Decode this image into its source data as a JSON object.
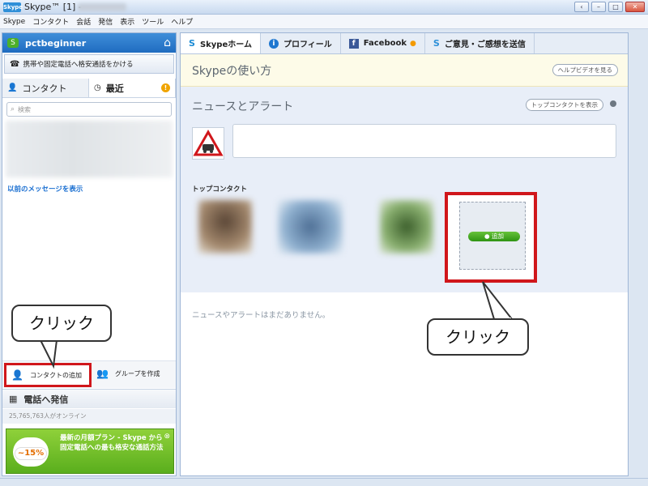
{
  "window": {
    "app_icon": "Skype",
    "title": "Skype™ [1] -",
    "buttons": [
      "‹",
      "–",
      "□",
      "✕"
    ]
  },
  "menubar": [
    "Skype",
    "コンタクト",
    "会話",
    "発信",
    "表示",
    "ツール",
    "ヘルプ"
  ],
  "left": {
    "user": {
      "name": "pctbeginner",
      "status_icon": "S",
      "home_icon": "⌂"
    },
    "call_link": "携帯や固定電話へ格安通話をかける",
    "tabs": [
      {
        "label": "コンタクト",
        "icon": "👤"
      },
      {
        "label": "最近",
        "icon": "◷",
        "badge": "!"
      }
    ],
    "search_placeholder": "検索",
    "show_previous": "以前のメッセージを表示",
    "add_contact": "コンタクトの追加",
    "create_group": "グループを作成",
    "call_phone": "電話へ発信",
    "online_count": "25,765,763人がオンライン",
    "promo": {
      "percent": "~15%",
      "text": "最新の月額プラン - Skype から固定電話への最も格安な通話方法",
      "close": "⊗"
    }
  },
  "right": {
    "tabs": [
      {
        "label": "Skypeホーム",
        "icon": "S",
        "active": true
      },
      {
        "label": "プロフィール",
        "icon": "i"
      },
      {
        "label": "Facebook",
        "icon": "f",
        "dot": "●"
      },
      {
        "label": "ご意見・ご感想を送信",
        "icon": "S"
      }
    ],
    "howto_title": "Skypeの使い方",
    "help_video": "ヘルプビデオを見る",
    "news_title": "ニュースとアラート",
    "top_contact_toggle": "トップコンタクトを表示",
    "top_contacts_label": "トップコンタクト",
    "add_button": "追加",
    "no_news": "ニュースやアラートはまだありません。"
  },
  "callouts": {
    "left": "クリック",
    "right": "クリック"
  },
  "colors": {
    "accent_blue": "#1f6cc0",
    "highlight_red": "#d0161b",
    "add_green": "#2f9413",
    "promo_green": "#5aae1d"
  }
}
